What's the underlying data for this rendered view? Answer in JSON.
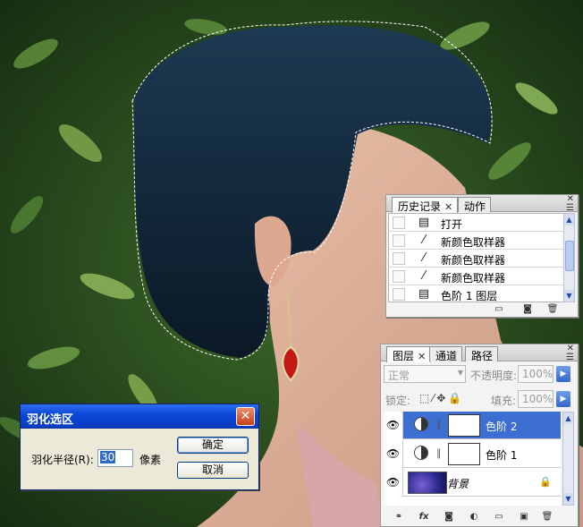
{
  "history_panel": {
    "tabs": [
      {
        "label": "历史记录",
        "active": true,
        "closable": true
      },
      {
        "label": "动作",
        "active": false,
        "closable": false
      }
    ],
    "items": [
      {
        "label": "打开",
        "icon": "document-icon"
      },
      {
        "label": "新颜色取样器",
        "icon": "eyedropper-icon"
      },
      {
        "label": "新颜色取样器",
        "icon": "eyedropper-icon"
      },
      {
        "label": "新颜色取样器",
        "icon": "eyedropper-icon"
      },
      {
        "label": "色阶 1 图层",
        "icon": "document-icon"
      }
    ]
  },
  "layers_panel": {
    "tabs": [
      {
        "label": "图层",
        "active": true,
        "closable": true
      },
      {
        "label": "通道",
        "active": false,
        "closable": false
      },
      {
        "label": "路径",
        "active": false,
        "closable": false
      }
    ],
    "blend_mode": "正常",
    "opacity_label": "不透明度:",
    "opacity_value": "100%",
    "lock_label": "锁定:",
    "fill_label": "填充:",
    "fill_value": "100%",
    "layers": [
      {
        "name": "色阶 2",
        "type": "adjustment",
        "selected": true
      },
      {
        "name": "色阶 1",
        "type": "adjustment",
        "selected": false
      },
      {
        "name": "背景",
        "type": "background",
        "selected": false
      }
    ]
  },
  "feather_dialog": {
    "title": "羽化选区",
    "radius_label": "羽化半径(R):",
    "radius_value": "30",
    "unit": "像素",
    "ok_label": "确定",
    "cancel_label": "取消"
  },
  "colors": {
    "xp_title_blue": "#0a46d6",
    "layer_selected": "#3c6fd1"
  }
}
